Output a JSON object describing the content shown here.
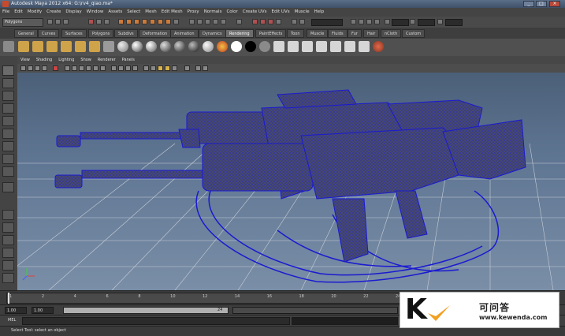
{
  "window": {
    "title": "Autodesk Maya 2012 x64: G:\\rv4_qiao.ma*"
  },
  "menus": [
    "File",
    "Edit",
    "Modify",
    "Create",
    "Display",
    "Window",
    "Assets",
    "Select",
    "Mesh",
    "Edit Mesh",
    "Proxy",
    "Normals",
    "Color",
    "Create UVs",
    "Edit UVs",
    "Muscle",
    "Help"
  ],
  "status_line": {
    "mode": "Polygons",
    "field1": "",
    "field2": "",
    "field3": ""
  },
  "shelf_tabs": [
    "General",
    "Curves",
    "Surfaces",
    "Polygons",
    "Subdivs",
    "Deformation",
    "Animation",
    "Dynamics",
    "Rendering",
    "PaintEffects",
    "Toon",
    "Muscle",
    "Fluids",
    "Fur",
    "Hair",
    "nCloth",
    "Custom"
  ],
  "active_shelf_tab": "Rendering",
  "panel_menu": [
    "View",
    "Shading",
    "Lighting",
    "Show",
    "Renderer",
    "Panels"
  ],
  "time_slider": {
    "ticks": [
      "1",
      "2",
      "4",
      "6",
      "8",
      "10",
      "12",
      "14",
      "16",
      "18",
      "20",
      "22",
      "24"
    ],
    "current": "1.00"
  },
  "range_slider": {
    "start": "1.00",
    "inner_start": "1.00",
    "inner_end": "24",
    "end": ""
  },
  "command_line": {
    "label": "MEL"
  },
  "help_line": {
    "text": "Select Tool: select an object"
  },
  "watermark": {
    "letter": "K",
    "name": "可问答",
    "url": "www.kewenda.com"
  },
  "colors": {
    "viewport_top": "#4b5f78",
    "viewport_bottom": "#7a8ea7",
    "wireframe": "#1a1ad0",
    "gun_body": "#4c4f58"
  }
}
